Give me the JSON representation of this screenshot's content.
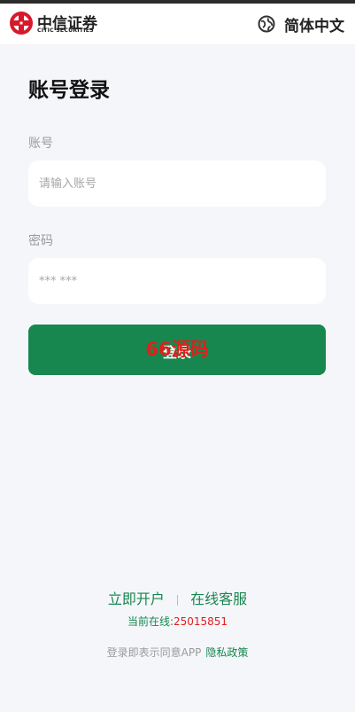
{
  "header": {
    "logo_cn": "中信证券",
    "logo_en": "CITIC SECURITIES",
    "language_label": "简体中文",
    "language_icon": "globe-icon"
  },
  "form": {
    "title": "账号登录",
    "account_label": "账号",
    "account_placeholder": "请输入账号",
    "account_value": "",
    "password_label": "密码",
    "password_placeholder": "*** ***",
    "password_value": "",
    "login_label": "登录",
    "overlay_text": "66源码"
  },
  "footer": {
    "open_account": "立即开户",
    "customer_service": "在线客服",
    "online_label": "当前在线:",
    "online_count": "25015851",
    "agree_text": "登录即表示同意APP",
    "privacy_link": "隐私政策"
  },
  "colors": {
    "brand_green": "#17874f",
    "accent_red": "#e0201b",
    "background": "#f5f6fa"
  }
}
